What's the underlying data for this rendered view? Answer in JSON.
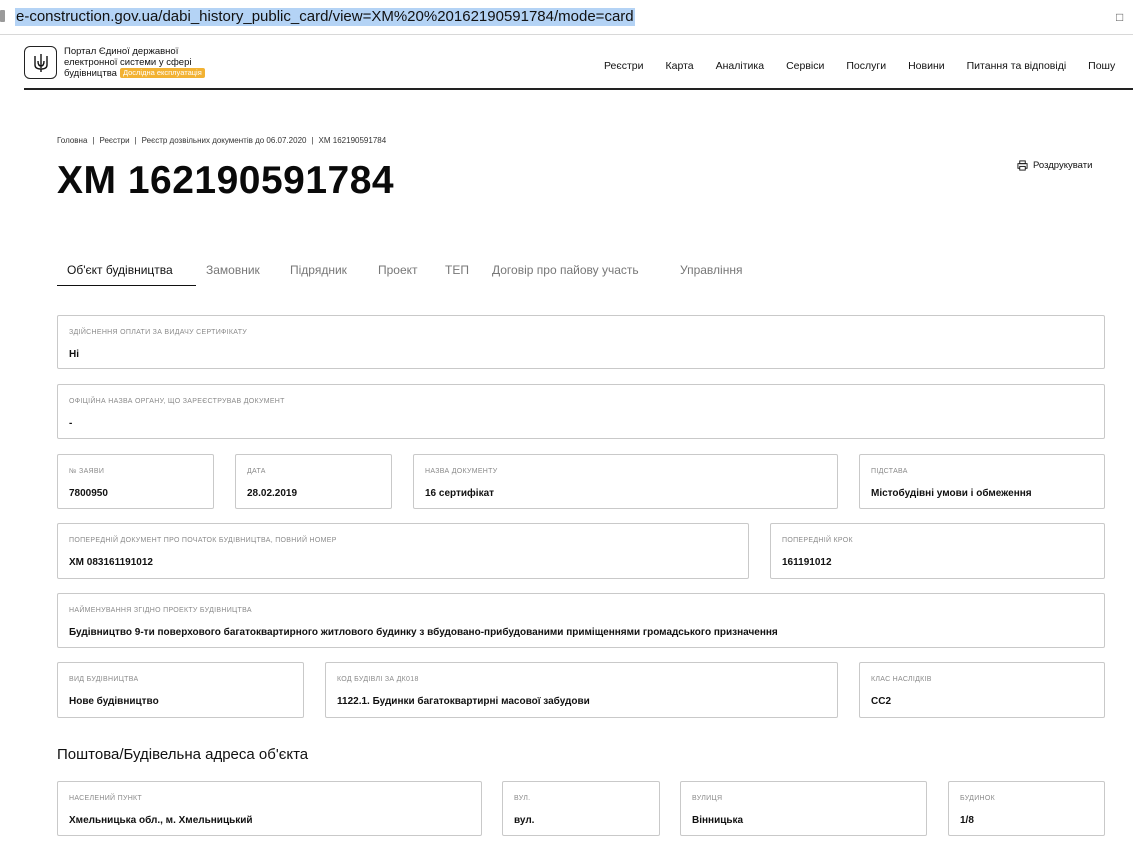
{
  "browser": {
    "url": "e-construction.gov.ua/dabi_history_public_card/view=XM%20%20162190591784/mode=card"
  },
  "header": {
    "portal_line1": "Портал Єдиної державної",
    "portal_line2": "електронної системи у сфері",
    "portal_line3": "будівництва",
    "badge": "Дослідна експлуатація",
    "nav": [
      "Реєстри",
      "Карта",
      "Аналітика",
      "Сервіси",
      "Послуги",
      "Новини",
      "Питання та відповіді",
      "Пошу"
    ]
  },
  "breadcrumbs": [
    "Головна",
    "Реєстри",
    "Реєстр дозвільних документів до 06.07.2020",
    "ХМ 162190591784"
  ],
  "page": {
    "title": "ХМ 162190591784",
    "print_label": "Роздрукувати"
  },
  "tabs": [
    "Об'єкт будівництва",
    "Замовник",
    "Підрядник",
    "Проект",
    "ТЕП",
    "Договір про пайову участь",
    "Управління"
  ],
  "fields": {
    "payment": {
      "label": "ЗДІЙСНЕННЯ ОПЛАТИ ЗА ВИДАЧУ СЕРТИФІКАТУ",
      "value": "Ні"
    },
    "authority": {
      "label": "ОФІЦІЙНА НАЗВА ОРГАНУ, ЩО ЗАРЕЄСТРУВАВ ДОКУМЕНТ",
      "value": "-"
    },
    "app_no": {
      "label": "№ ЗАЯВИ",
      "value": "7800950"
    },
    "date": {
      "label": "ДАТА",
      "value": "28.02.2019"
    },
    "doc_name": {
      "label": "НАЗВА ДОКУМЕНТУ",
      "value": "16 сертифікат"
    },
    "basis": {
      "label": "ПІДСТАВА",
      "value": "Містобудівні умови і обмеження"
    },
    "prev_doc": {
      "label": "ПОПЕРЕДНІЙ ДОКУМЕНТ ПРО ПОЧАТОК БУДІВНИЦТВА, ПОВНИЙ НОМЕР",
      "value": "ХМ 083161191012"
    },
    "prev_step": {
      "label": "ПОПЕРЕДНІЙ КРОК",
      "value": "161191012"
    },
    "project_name": {
      "label": "НАЙМЕНУВАННЯ ЗГІДНО ПРОЕКТУ БУДІВНИЦТВА",
      "value": "Будівництво 9-ти поверхового багатоквартирного житлового будинку з вбудовано-прибудованими приміщеннями громадського призначення"
    },
    "construction_type": {
      "label": "ВИД БУДІВНИЦТВА",
      "value": "Нове будівництво"
    },
    "building_code": {
      "label": "КОД БУДІВЛІ ЗА ДК018",
      "value": "1122.1. Будинки багатоквартирні масової забудови"
    },
    "consequence_class": {
      "label": "КЛАС НАСЛІДКІВ",
      "value": "СС2"
    }
  },
  "address_section": {
    "title": "Поштова/Будівельна адреса об'єкта",
    "locality": {
      "label": "НАСЕЛЕНИЙ ПУНКТ",
      "value": "Хмельницька обл., м. Хмельницький"
    },
    "street_type": {
      "label": "ВУЛ.",
      "value": "вул."
    },
    "street": {
      "label": "ВУЛИЦЯ",
      "value": "Вінницька"
    },
    "house": {
      "label": "БУДИНОК",
      "value": "1/8"
    }
  }
}
